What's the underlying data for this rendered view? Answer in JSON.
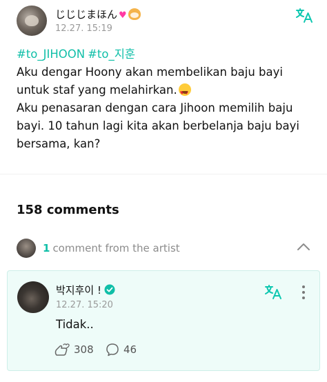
{
  "post": {
    "author_name": "じじじまほん",
    "author_emojis": [
      "heart-icon",
      "dog-face-icon"
    ],
    "time": "12.27. 15:19",
    "hashtags": [
      "#to_JIHOON",
      "#to_지훈"
    ],
    "body_line1": "Aku dengar Hoony akan membelikan baju bayi",
    "body_line2": "untuk staf yang melahirkan.",
    "body_emoji": "heart-eyes-emoji",
    "body_line3": "Aku penasaran dengan cara Jihoon memilih baju",
    "body_line4": "bayi. 10 tahun lagi kita akan berbelanja baju bayi",
    "body_line5": "bersama, kan?"
  },
  "comments": {
    "count_label": "158 comments"
  },
  "artist_section": {
    "count": "1",
    "label": "comment from the artist",
    "toggle_icon": "chevron-up-icon"
  },
  "artist_comment": {
    "name": "박지후이 !",
    "verified_icon": "verified-badge-icon",
    "time": "12.27. 15:20",
    "text": "Tidak..",
    "likes": "308",
    "replies": "46"
  },
  "colors": {
    "accent": "#10bfa8",
    "card_background": "#eefcf9",
    "muted_text": "#9a9a9a"
  }
}
